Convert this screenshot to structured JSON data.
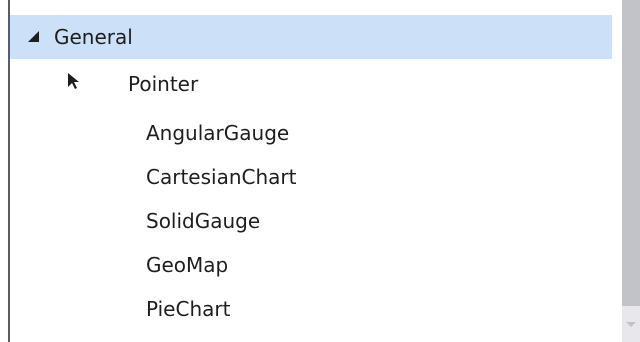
{
  "toolbox": {
    "group": {
      "label": "General",
      "expanded": true
    },
    "items": [
      {
        "label": "Pointer",
        "icon": "pointer-arrow-icon"
      },
      {
        "label": "AngularGauge"
      },
      {
        "label": "CartesianChart"
      },
      {
        "label": "SolidGauge"
      },
      {
        "label": "GeoMap"
      },
      {
        "label": "PieChart"
      }
    ]
  },
  "colors": {
    "selected_background": "#cce0f7",
    "text": "#1e1e1e",
    "scrollbar_track": "#e8e8ec",
    "scrollbar_thumb": "#c2c3c9"
  }
}
